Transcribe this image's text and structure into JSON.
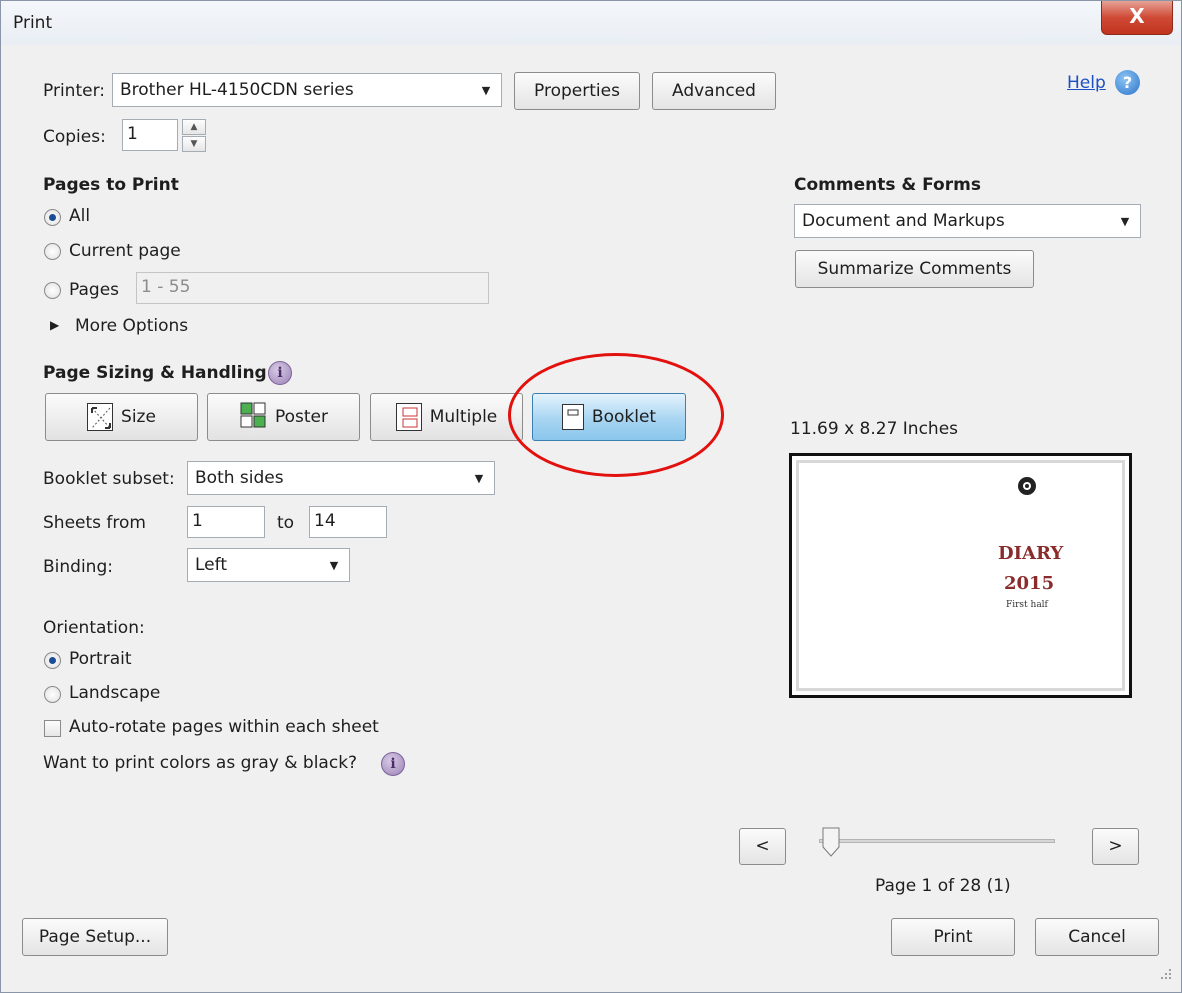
{
  "window": {
    "title": "Print",
    "close_label": "X"
  },
  "printer": {
    "label": "Printer:",
    "selected": "Brother HL-4150CDN series",
    "properties_label": "Properties",
    "advanced_label": "Advanced",
    "help_label": "Help"
  },
  "copies": {
    "label": "Copies:",
    "value": "1"
  },
  "pages_to_print": {
    "heading": "Pages to Print",
    "all_label": "All",
    "current_label": "Current page",
    "pages_label": "Pages",
    "pages_range": "1 - 55",
    "more_options_label": "More Options",
    "selected": "All"
  },
  "sizing": {
    "heading": "Page Sizing & Handling",
    "modes": [
      {
        "label": "Size",
        "icon": "size-icon"
      },
      {
        "label": "Poster",
        "icon": "poster-icon"
      },
      {
        "label": "Multiple",
        "icon": "multiple-icon"
      },
      {
        "label": "Booklet",
        "icon": "booklet-icon"
      }
    ],
    "active_mode": "Booklet"
  },
  "booklet": {
    "subset_label": "Booklet subset:",
    "subset_value": "Both sides",
    "sheets_from_label": "Sheets from",
    "sheets_from": "1",
    "to_label": "to",
    "sheets_to": "14",
    "binding_label": "Binding:",
    "binding_value": "Left"
  },
  "orientation": {
    "heading": "Orientation:",
    "portrait_label": "Portrait",
    "landscape_label": "Landscape",
    "selected": "Portrait",
    "auto_rotate_label": "Auto-rotate pages within each sheet",
    "auto_rotate_checked": false,
    "gray_label": "Want to print colors as gray & black?"
  },
  "comments_forms": {
    "heading": "Comments & Forms",
    "selected": "Document and Markups",
    "summarize_label": "Summarize Comments"
  },
  "preview": {
    "size_label": "11.69 x 8.27 Inches",
    "diary_title": "DIARY",
    "diary_year": "2015",
    "diary_subtitle": "First half",
    "prev_label": "<",
    "next_label": ">",
    "page_status": "Page 1 of 28 (1)"
  },
  "footer": {
    "page_setup_label": "Page Setup...",
    "print_label": "Print",
    "cancel_label": "Cancel"
  },
  "colors": {
    "accent_annotation": "#e2110e",
    "active_button": "#a8d5f2",
    "link": "#1a4fc4"
  }
}
